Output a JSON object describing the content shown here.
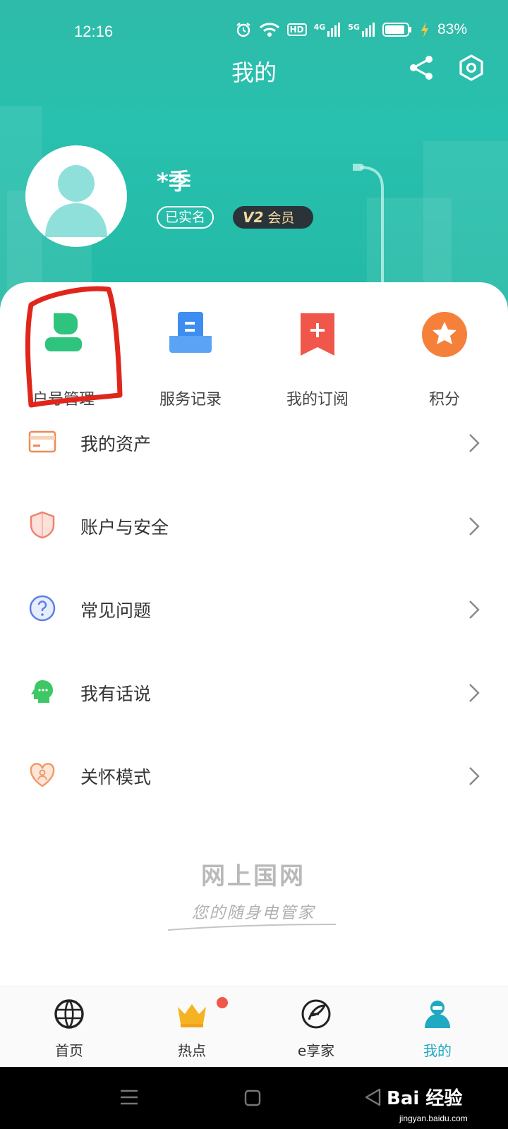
{
  "status_bar": {
    "time": "12:16",
    "battery_percent": "83%",
    "net1": "4G",
    "net2": "5G",
    "hd": "HD"
  },
  "header": {
    "title": "我的"
  },
  "profile": {
    "name": "*季",
    "verified_label": "已实名",
    "vip_level": "V2",
    "vip_label": "会员"
  },
  "quick_actions": [
    {
      "label": "户号管理",
      "icon": "account-icon",
      "color": "#2ec47e"
    },
    {
      "label": "服务记录",
      "icon": "service-record-icon",
      "color": "#3d8ef0"
    },
    {
      "label": "我的订阅",
      "icon": "subscribe-icon",
      "color": "#f0564a"
    },
    {
      "label": "积分",
      "icon": "star-icon",
      "color": "#f5803a"
    }
  ],
  "menu": [
    {
      "label": "我的资产",
      "icon": "card-icon"
    },
    {
      "label": "账户与安全",
      "icon": "shield-icon"
    },
    {
      "label": "常见问题",
      "icon": "question-icon"
    },
    {
      "label": "我有话说",
      "icon": "chat-head-icon"
    },
    {
      "label": "关怀模式",
      "icon": "heart-icon"
    }
  ],
  "brand": {
    "name": "网上国网",
    "slogan": "您的随身电管家"
  },
  "tabbar": [
    {
      "label": "首页",
      "icon": "globe-icon"
    },
    {
      "label": "热点",
      "icon": "crown-icon"
    },
    {
      "label": "e享家",
      "icon": "e-leaf-icon"
    },
    {
      "label": "我的",
      "icon": "profile-icon"
    }
  ],
  "watermark": {
    "text": "Bai 经验",
    "url": "jingyan.baidu.com"
  },
  "colors": {
    "header": "#23b9a6",
    "active_tab": "#1fa9c2",
    "highlight": "#e0261b"
  }
}
